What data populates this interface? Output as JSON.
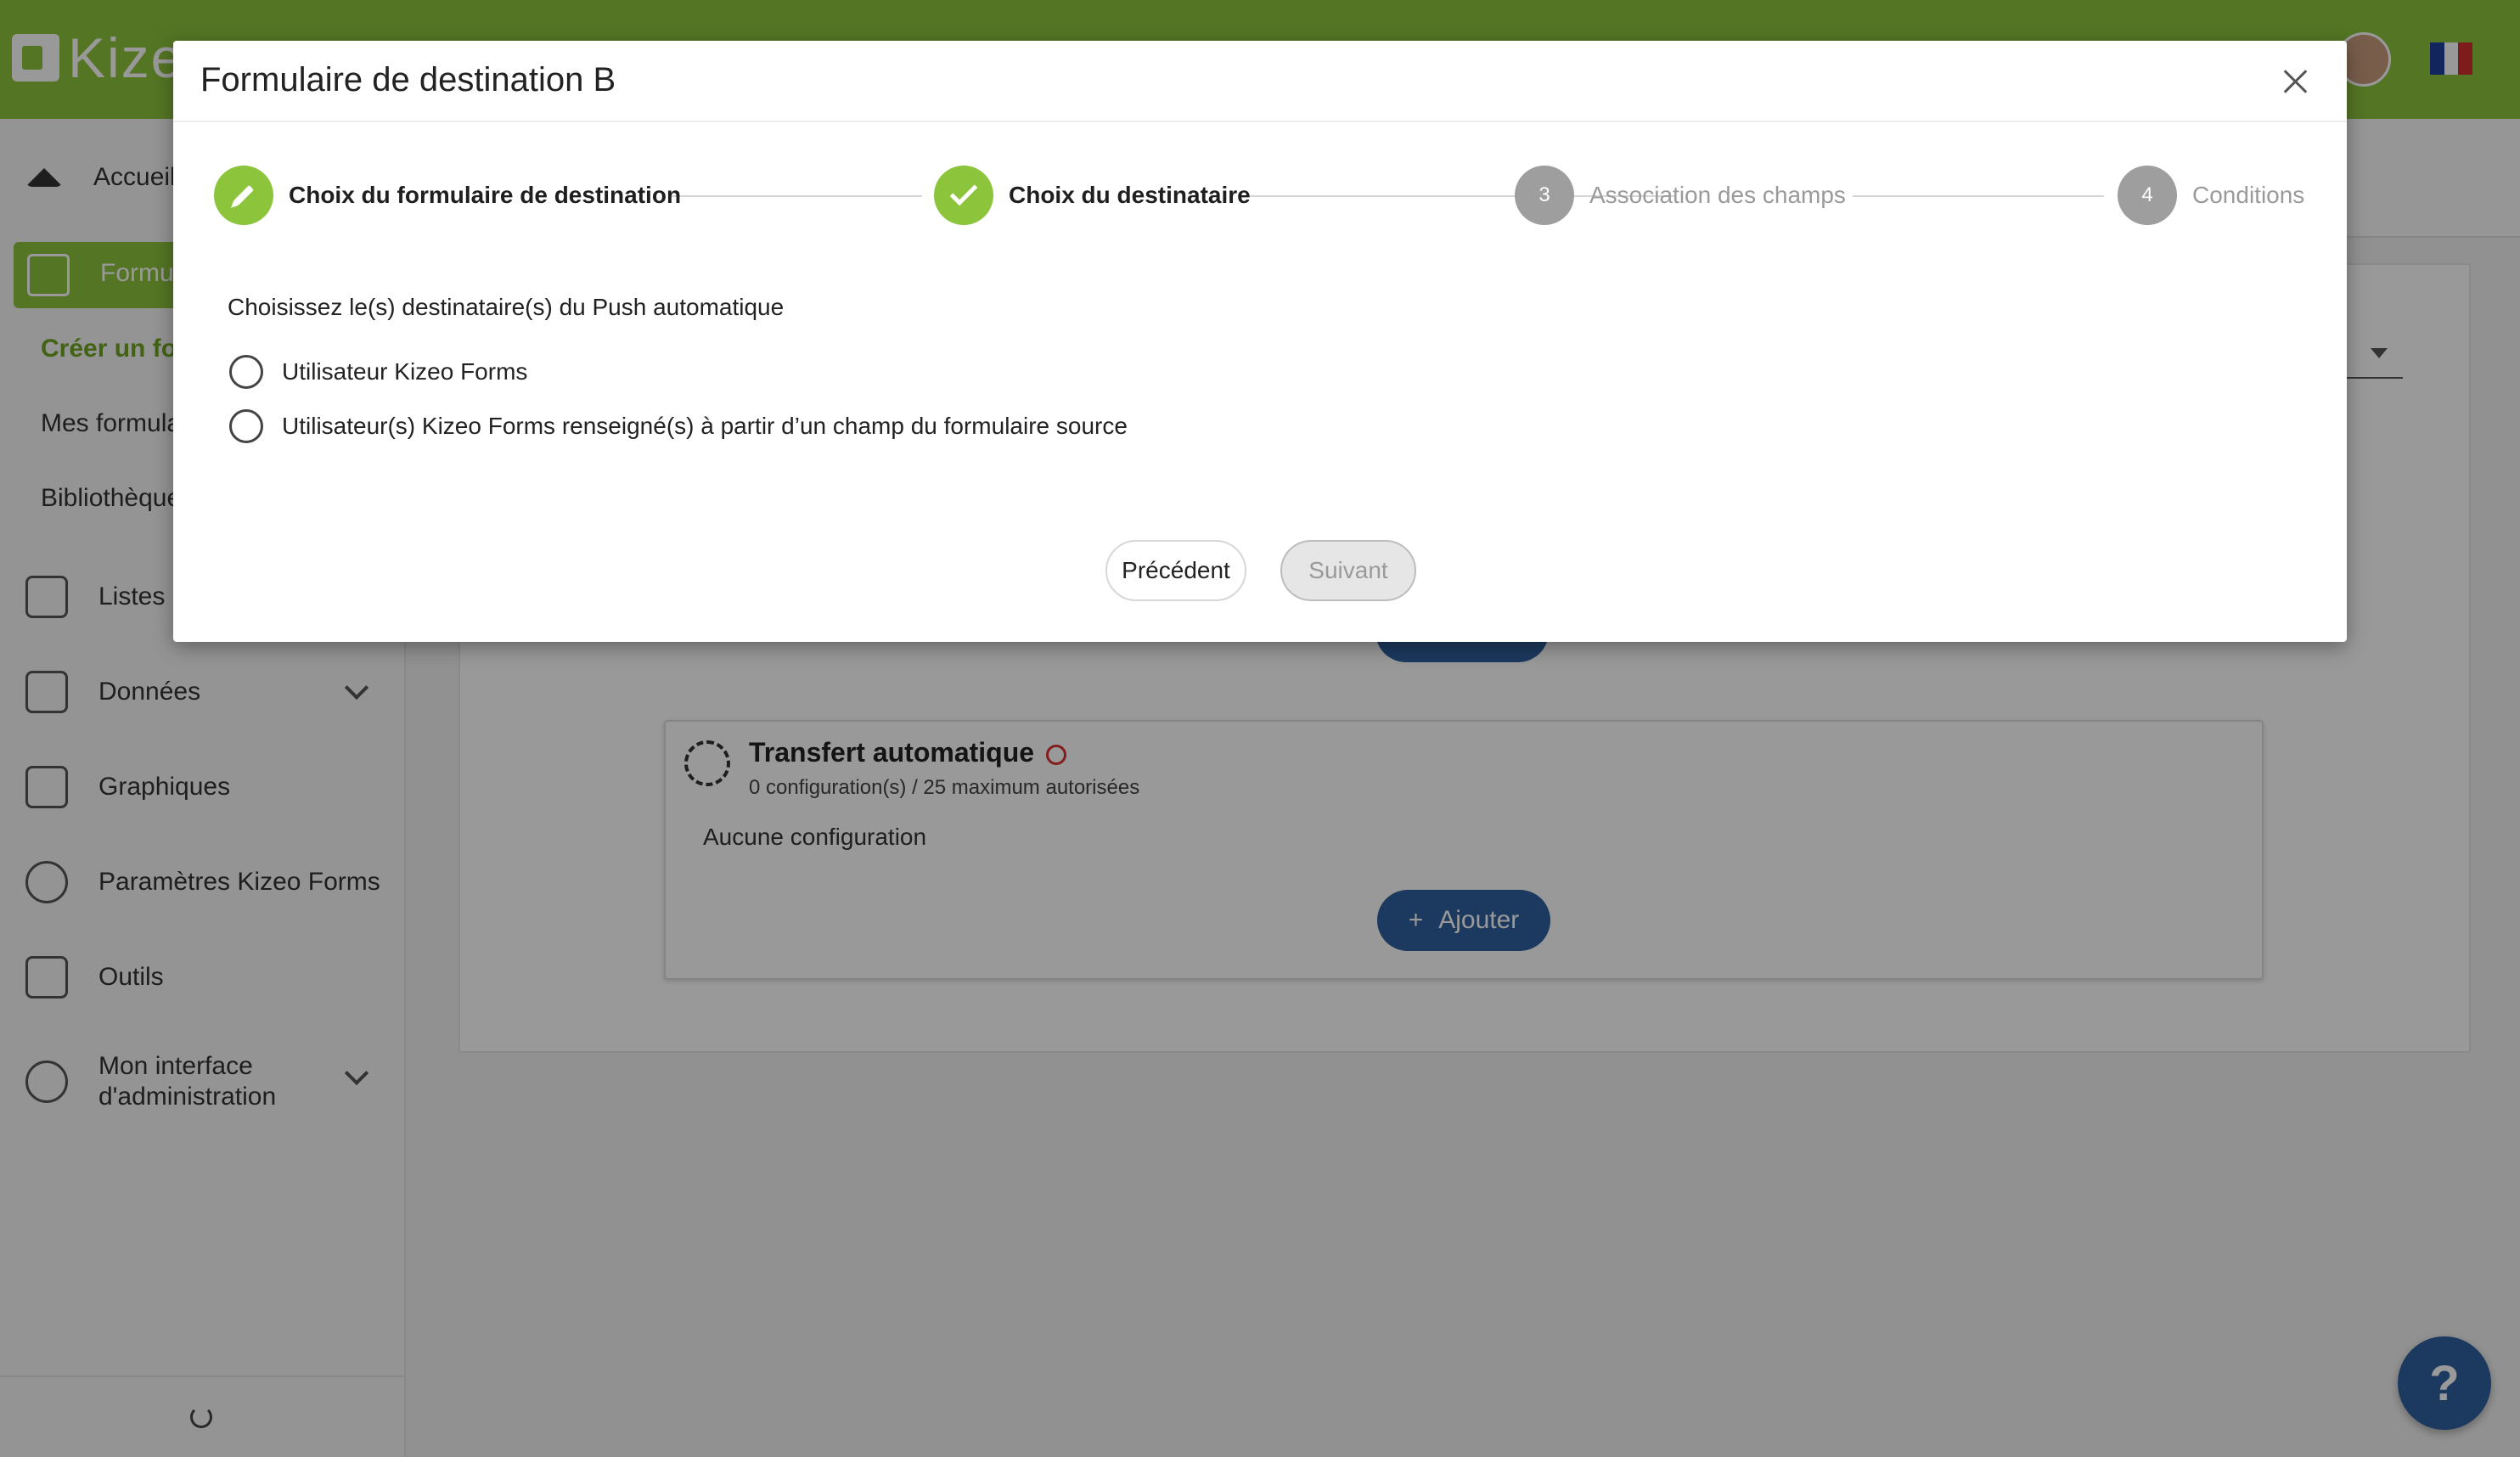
{
  "app": {
    "logo_text": "Kizeo",
    "brand_color": "#8cc43c",
    "accent_blue": "#2f5f9f"
  },
  "sidebar": {
    "items": [
      {
        "label": "Accueil"
      },
      {
        "label": "Formulaires"
      },
      {
        "label": "Listes externes"
      },
      {
        "label": "Données"
      },
      {
        "label": "Graphiques"
      },
      {
        "label": "Paramètres Kizeo Forms"
      },
      {
        "label": "Outils"
      },
      {
        "label": "Mon interface d'administration"
      }
    ],
    "sub_items": [
      {
        "label": "Créer un formulaire"
      },
      {
        "label": "Mes formulaires"
      },
      {
        "label": "Bibliothèque"
      }
    ]
  },
  "background": {
    "card": {
      "title": "Transfert automatique",
      "subtitle": "0 configuration(s) / 25 maximum autorisées",
      "empty_text": "Aucune configuration",
      "add_label": "Ajouter"
    }
  },
  "help": {
    "label": "?"
  },
  "modal": {
    "title": "Formulaire de destination B",
    "steps": [
      {
        "number": "1",
        "label": "Choix du formulaire de destination",
        "state": "done",
        "icon": "pencil-icon"
      },
      {
        "number": "2",
        "label": "Choix du destinataire",
        "state": "done",
        "icon": "check-icon"
      },
      {
        "number": "3",
        "label": "Association des champs",
        "state": "todo"
      },
      {
        "number": "4",
        "label": "Conditions",
        "state": "todo"
      }
    ],
    "question": "Choisissez le(s) destinataire(s) du Push automatique",
    "options": [
      {
        "label": "Utilisateur Kizeo Forms",
        "selected": false
      },
      {
        "label": "Utilisateur(s) Kizeo Forms renseigné(s) à partir d’un champ du formulaire source",
        "selected": false
      }
    ],
    "buttons": {
      "previous": "Précédent",
      "next": "Suivant"
    }
  }
}
